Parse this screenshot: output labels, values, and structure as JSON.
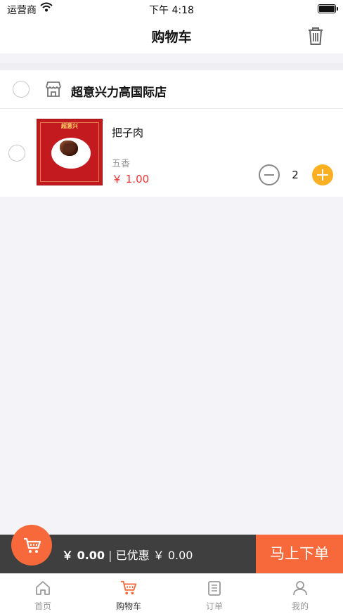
{
  "status_bar": {
    "carrier": "运营商",
    "time": "下午 4:18"
  },
  "nav": {
    "title": "购物车",
    "trash_icon": "trash-icon"
  },
  "store": {
    "name": "超意兴力高国际店",
    "icon": "store-icon",
    "items": [
      {
        "name": "把子肉",
        "spec": "五香",
        "price": "￥ 1.00",
        "quantity": "2",
        "image_brand": "超意兴"
      }
    ]
  },
  "checkout": {
    "total": "￥ 0.00",
    "separator": "|",
    "discount": "已优惠 ￥ 0.00",
    "submit_label": "马上下单",
    "cart_icon": "cart-icon"
  },
  "tabs": [
    {
      "label": "首页",
      "icon": "home-icon",
      "active": false
    },
    {
      "label": "购物车",
      "icon": "cart-icon",
      "active": true
    },
    {
      "label": "订单",
      "icon": "order-list-icon",
      "active": false
    },
    {
      "label": "我的",
      "icon": "profile-icon",
      "active": false
    }
  ],
  "colors": {
    "accent": "#f7693a",
    "plus_button": "#fbb023",
    "price": "#f23030",
    "checkout_bar": "#3f3f3f"
  }
}
